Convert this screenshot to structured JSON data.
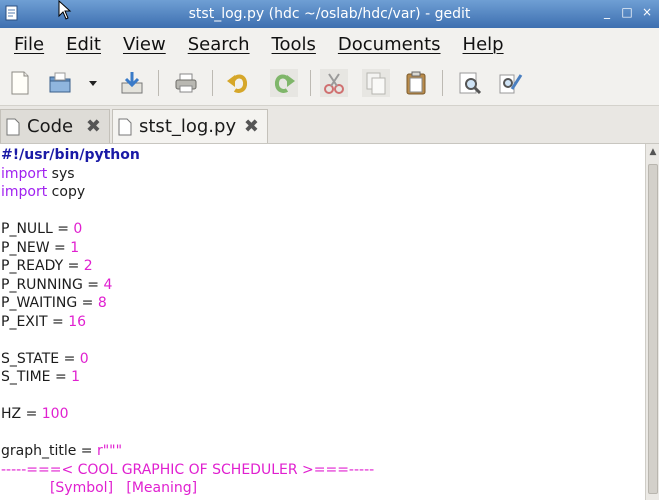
{
  "window": {
    "title": "stst_log.py (hdc ~/oslab/hdc/var) - gedit",
    "controls": [
      "_",
      "□",
      "×"
    ]
  },
  "menubar": {
    "items": [
      "File",
      "Edit",
      "View",
      "Search",
      "Tools",
      "Documents",
      "Help"
    ]
  },
  "toolbar": {
    "icons": [
      "new-document-icon",
      "open-icon",
      "dropdown-arrow-icon",
      "save-icon",
      "print-icon",
      "undo-icon",
      "redo-icon",
      "cut-icon",
      "copy-icon",
      "paste-icon",
      "find-icon",
      "replace-icon"
    ]
  },
  "tabs": [
    {
      "label": "Code",
      "active": false
    },
    {
      "label": "stst_log.py",
      "active": true
    }
  ],
  "editor": {
    "lines": [
      [
        {
          "t": "#!/usr/bin/python",
          "c": "shebang"
        }
      ],
      [
        {
          "t": "import",
          "c": "kw"
        },
        {
          "t": " sys",
          "c": ""
        }
      ],
      [
        {
          "t": "import",
          "c": "kw"
        },
        {
          "t": " copy",
          "c": ""
        }
      ],
      [],
      [
        {
          "t": "P_NULL = ",
          "c": ""
        },
        {
          "t": "0",
          "c": "num"
        }
      ],
      [
        {
          "t": "P_NEW = ",
          "c": ""
        },
        {
          "t": "1",
          "c": "num"
        }
      ],
      [
        {
          "t": "P_READY = ",
          "c": ""
        },
        {
          "t": "2",
          "c": "num"
        }
      ],
      [
        {
          "t": "P_RUNNING = ",
          "c": ""
        },
        {
          "t": "4",
          "c": "num"
        }
      ],
      [
        {
          "t": "P_WAITING = ",
          "c": ""
        },
        {
          "t": "8",
          "c": "num"
        }
      ],
      [
        {
          "t": "P_EXIT = ",
          "c": ""
        },
        {
          "t": "16",
          "c": "num"
        }
      ],
      [],
      [
        {
          "t": "S_STATE = ",
          "c": ""
        },
        {
          "t": "0",
          "c": "num"
        }
      ],
      [
        {
          "t": "S_TIME = ",
          "c": ""
        },
        {
          "t": "1",
          "c": "num"
        }
      ],
      [],
      [
        {
          "t": "HZ = ",
          "c": ""
        },
        {
          "t": "100",
          "c": "num"
        }
      ],
      [],
      [
        {
          "t": "graph_title = ",
          "c": ""
        },
        {
          "t": "r\"\"\"",
          "c": "str"
        }
      ],
      [
        {
          "t": "-----===< COOL GRAPHIC OF SCHEDULER >===-----",
          "c": "str"
        }
      ],
      [
        {
          "t": "           [Symbol]   [Meaning]",
          "c": "str"
        }
      ]
    ]
  },
  "colors": {
    "keyword": "#a020f0",
    "number": "#e020d0",
    "shebang": "#1a1aa6",
    "titlebar": "#3d6fb0"
  }
}
